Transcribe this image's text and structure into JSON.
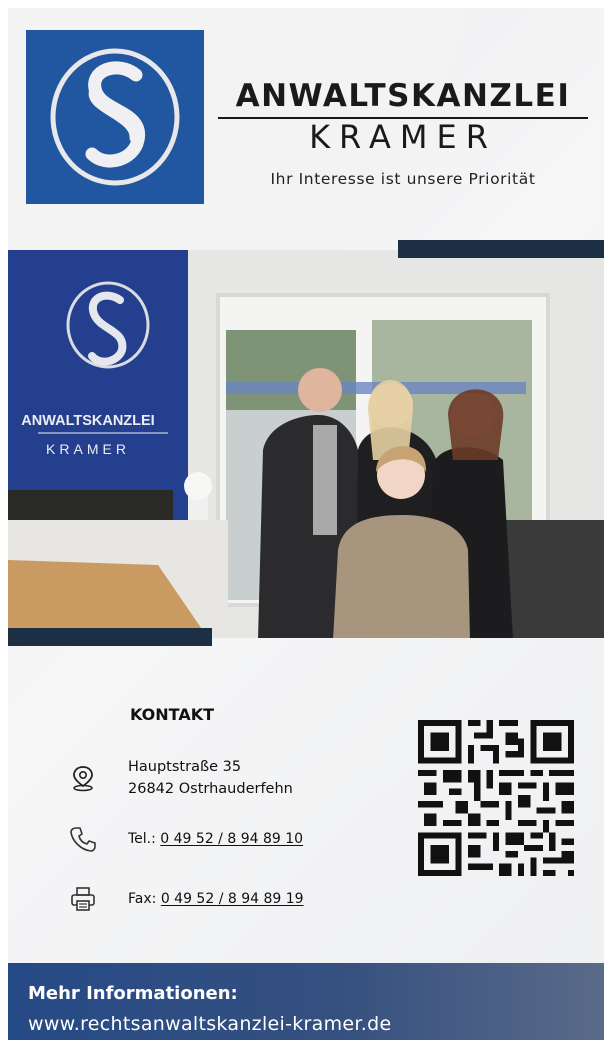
{
  "header": {
    "title": "ANWALTSKANZLEI",
    "name": "KRAMER",
    "tagline": "Ihr Interesse ist unsere Priorität"
  },
  "photo": {
    "wall_sign_title": "ANWALTSKANZLEI",
    "wall_sign_name": "KRAMER"
  },
  "contact": {
    "heading": "KONTAKT",
    "address_line1": "Hauptstraße 35",
    "address_line2": "26842 Ostrhauderfehn",
    "tel_label": "Tel.: ",
    "tel_number": "0 49 52 / 8 94 89 10",
    "fax_label": "Fax: ",
    "fax_number": "0 49 52 / 8 94 89 19"
  },
  "footer": {
    "title": "Mehr Informationen:",
    "url": "www.rechtsanwaltskanzlei-kramer.de"
  },
  "colors": {
    "brand_blue": "#2156a0",
    "dark_bar": "#1d2f44"
  },
  "icons": [
    "paragraph-logo-icon",
    "location-pin-icon",
    "phone-icon",
    "fax-icon",
    "qr-code"
  ]
}
